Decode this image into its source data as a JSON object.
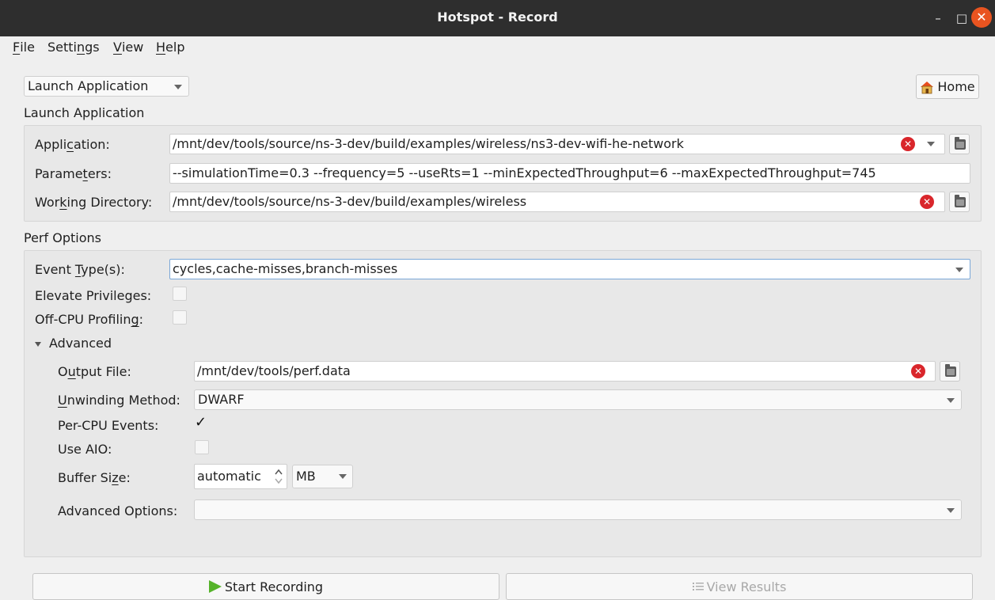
{
  "window": {
    "title": "Hotspot - Record",
    "controls": {
      "minimize": "–",
      "maximize": "□",
      "close": "✕"
    }
  },
  "menu": [
    {
      "prefix": "",
      "mnemonic": "F",
      "rest": "ile"
    },
    {
      "prefix": "Setti",
      "mnemonic": "n",
      "rest": "gs"
    },
    {
      "prefix": "",
      "mnemonic": "V",
      "rest": "iew"
    },
    {
      "prefix": "",
      "mnemonic": "H",
      "rest": "elp"
    }
  ],
  "mode_select": {
    "value": "Launch Application"
  },
  "home_button": {
    "label": "Home"
  },
  "launch": {
    "section_title": "Launch Application",
    "application": {
      "label_pre": "Appli",
      "label_mn": "c",
      "label_post": "ation:",
      "value": "/mnt/dev/tools/source/ns-3-dev/build/examples/wireless/ns3-dev-wifi-he-network"
    },
    "parameters": {
      "label_pre": "Parame",
      "label_mn": "t",
      "label_post": "ers:",
      "value": "--simulationTime=0.3 --frequency=5 --useRts=1 --minExpectedThroughput=6 --maxExpectedThroughput=745"
    },
    "working_directory": {
      "label_pre": "Wor",
      "label_mn": "k",
      "label_post": "ing Directory:",
      "value": "/mnt/dev/tools/source/ns-3-dev/build/examples/wireless"
    }
  },
  "perf": {
    "section_title": "Perf Options",
    "event_types": {
      "label_pre": "Event ",
      "label_mn": "T",
      "label_post": "ype(s):",
      "value": "cycles,cache-misses,branch-misses"
    },
    "elevate_privileges": {
      "label": "Elevate Privileges:",
      "checked": false
    },
    "offcpu_profiling": {
      "label_pre": "Off-CPU Profilin",
      "label_mn": "g",
      "label_post": ":",
      "checked": false
    },
    "advanced": {
      "toggle_label": "Advanced",
      "output_file": {
        "label_pre": "O",
        "label_mn": "u",
        "label_post": "tput File:",
        "value": "/mnt/dev/tools/perf.data"
      },
      "unwinding_method": {
        "label_pre": "",
        "label_mn": "U",
        "label_post": "nwinding Method:",
        "value": "DWARF"
      },
      "per_cpu_events": {
        "label": "Per-CPU Events:",
        "checked": true,
        "mark": "✓"
      },
      "use_aio": {
        "label": "Use AIO:",
        "checked": false
      },
      "buffer_size": {
        "label_pre": "Buffer Si",
        "label_mn": "z",
        "label_post": "e:",
        "value": "automatic",
        "unit": "MB"
      },
      "advanced_options": {
        "label": "Advanced Options:",
        "value": ""
      }
    }
  },
  "footer": {
    "start_recording": "Start Recording",
    "view_results": "View Results"
  }
}
